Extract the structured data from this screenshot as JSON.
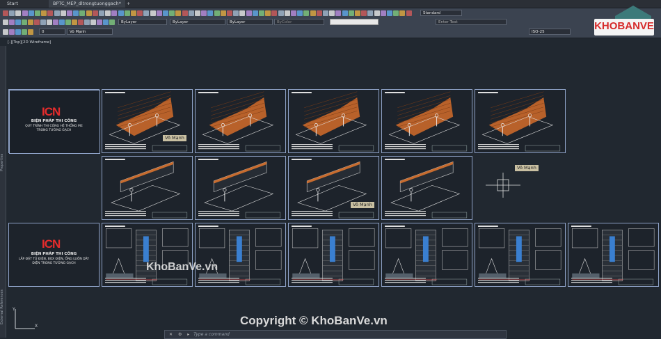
{
  "tabs": [
    {
      "label": "Start"
    },
    {
      "label": "BPTC_MEP_dltrongtuonggach*"
    }
  ],
  "toolbar": {
    "text_style": "Standard",
    "layer_value": "0",
    "layer_name": "Võ Mạnh",
    "linetype1": "ByLayer",
    "linetype2": "ByLayer",
    "lineweight": "ByLayer",
    "color": "ByColor",
    "search_placeholder": "Enter Text",
    "dim_style": "ISO-25"
  },
  "viewport": {
    "label": "[-][Top][2D Wireframe]"
  },
  "side_palettes": [
    "Properties",
    "External References"
  ],
  "sheets": {
    "row1_cover": {
      "logo": "ICN",
      "title": "BIỆN PHÁP THI CÔNG",
      "line1": "QUY TRÌNH THI CÔNG HỆ THỐNG ME",
      "line2": "TRONG TƯỜNG GẠCH"
    },
    "row3_cover": {
      "logo": "ICN",
      "title": "BIỆN PHÁP THI CÔNG",
      "line1": "LẮP ĐẶT TỦ ĐIỆN, BOX ĐIỆN, ỐNG LUỒN DÂY",
      "line2": "ĐIỆN TRONG TƯỜNG GẠCH"
    }
  },
  "tags": [
    "Võ Mạnh",
    "Võ Mạnh",
    "Võ Mạnh"
  ],
  "watermarks": {
    "center": "KhoBanVe.vn",
    "copyright": "Copyright © KhoBanVe.vn",
    "logo": "KHOBANVE"
  },
  "command": {
    "placeholder": "Type a command"
  }
}
